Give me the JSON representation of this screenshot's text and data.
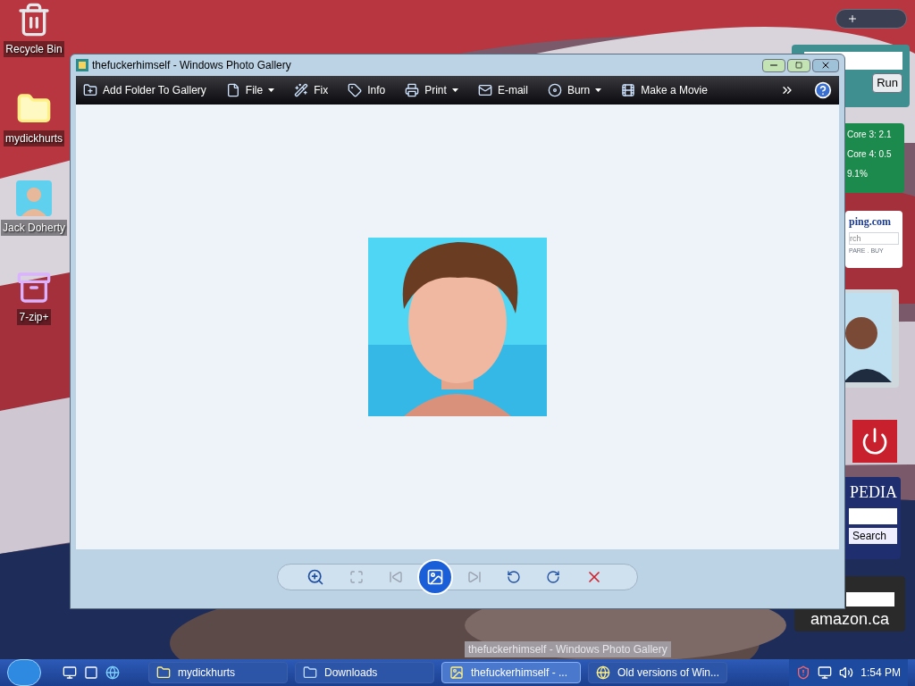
{
  "desktop": {
    "icons": [
      {
        "label": "Recycle Bin",
        "kind": "recycle"
      },
      {
        "label": "mydickhurts",
        "kind": "folder"
      },
      {
        "label": "Jack Doherty",
        "kind": "avatar"
      },
      {
        "label": "7-zip+",
        "kind": "archive"
      }
    ]
  },
  "window": {
    "title": "thefuckerhimself - Windows Photo Gallery",
    "toolbar": [
      {
        "label": "Add Folder To Gallery",
        "kind": "add-folder",
        "menu": false
      },
      {
        "label": "File",
        "kind": "file",
        "menu": true
      },
      {
        "label": "Fix",
        "kind": "fix",
        "menu": false
      },
      {
        "label": "Info",
        "kind": "info",
        "menu": false
      },
      {
        "label": "Print",
        "kind": "print",
        "menu": true
      },
      {
        "label": "E-mail",
        "kind": "email",
        "menu": false
      },
      {
        "label": "Burn",
        "kind": "burn",
        "menu": true
      },
      {
        "label": "Make a Movie",
        "kind": "movie",
        "menu": false
      }
    ]
  },
  "tooltip": "thefuckerhimself - Windows Photo Gallery",
  "gadgets": {
    "run": {
      "button": "Run"
    },
    "cpu": {
      "lines": [
        "Core 3: 2.1",
        "Core 4: 0.5",
        "9.1%"
      ]
    },
    "pricing": {
      "logo": "ping.com",
      "placeholder": "rch",
      "tagline": "PARE . BUY"
    },
    "wiki": {
      "logo": "PEDIA",
      "button": "Search"
    },
    "amazon": {
      "logo": "amazon.ca"
    }
  },
  "taskbar": {
    "buttons": [
      {
        "label": "mydickhurts",
        "kind": "folder",
        "selected": false
      },
      {
        "label": "Downloads",
        "kind": "downloads",
        "selected": false
      },
      {
        "label": "thefuckerhimself - ...",
        "kind": "gallery",
        "selected": true
      },
      {
        "label": "Old versions of Win...",
        "kind": "browser",
        "selected": false
      }
    ],
    "clock": "1:54 PM"
  }
}
